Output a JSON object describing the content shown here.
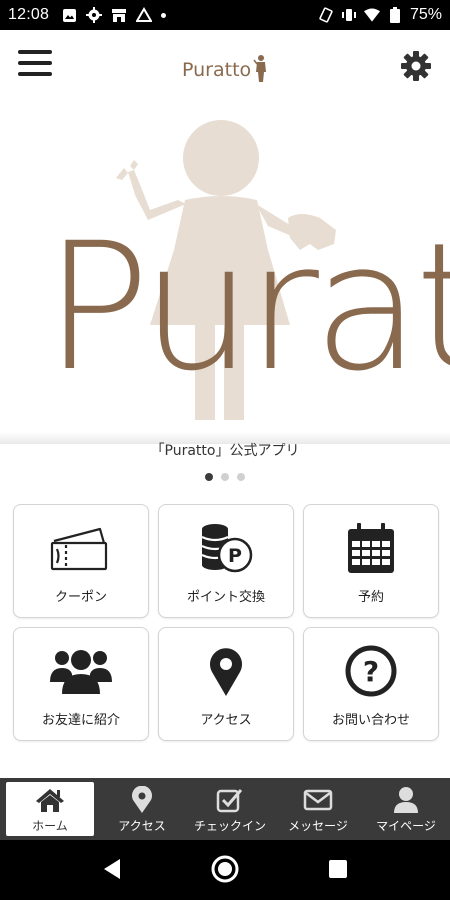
{
  "status_bar": {
    "time": "12:08",
    "battery": "75%"
  },
  "header": {
    "logo_text": "Puratto",
    "menu_icon": "hamburger-menu-icon",
    "settings_icon": "gear-icon"
  },
  "hero": {
    "logo_text": "Puratto",
    "caption": "「Puratto」公式アプリ",
    "slides": 3,
    "active_slide": 1
  },
  "tiles": [
    {
      "label": "クーポン",
      "icon": "ticket-icon"
    },
    {
      "label": "ポイント交換",
      "icon": "coins-point-icon"
    },
    {
      "label": "予約",
      "icon": "calendar-icon"
    },
    {
      "label": "お友達に紹介",
      "icon": "users-group-icon"
    },
    {
      "label": "アクセス",
      "icon": "map-pin-icon"
    },
    {
      "label": "お問い合わせ",
      "icon": "question-circle-icon"
    }
  ],
  "bottom_nav": [
    {
      "label": "ホーム",
      "icon": "home-icon",
      "active": true
    },
    {
      "label": "アクセス",
      "icon": "map-pin-icon",
      "active": false
    },
    {
      "label": "チェックイン",
      "icon": "checkbox-icon",
      "active": false
    },
    {
      "label": "メッセージ",
      "icon": "envelope-icon",
      "active": false
    },
    {
      "label": "マイページ",
      "icon": "user-icon",
      "active": false
    }
  ],
  "colors": {
    "brand_brown": "#8a6a4e",
    "silhouette_beige": "#e7ddd2",
    "nav_bg": "#3a3a3a"
  }
}
